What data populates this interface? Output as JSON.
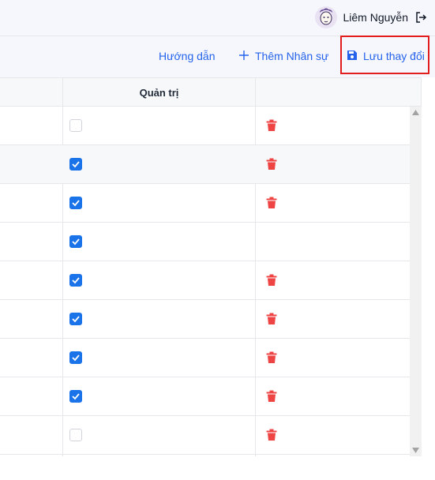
{
  "header": {
    "user_name": "Liêm Nguyễn",
    "avatar_icon": "avatar-face-icon",
    "logout_icon": "logout-icon"
  },
  "toolbar": {
    "guide_label": "Hướng dẫn",
    "add_label": "Thêm Nhân sự",
    "add_icon": "plus-icon",
    "save_label": "Lưu thay đổi",
    "save_icon": "floppy-disk-icon",
    "accent_color": "#2563eb",
    "highlight_color": "#e11d1d"
  },
  "table": {
    "columns": [
      "",
      "Quản trị",
      ""
    ],
    "rows": [
      {
        "admin": false,
        "deletable": true
      },
      {
        "admin": true,
        "deletable": true
      },
      {
        "admin": true,
        "deletable": true
      },
      {
        "admin": true,
        "deletable": false
      },
      {
        "admin": true,
        "deletable": true
      },
      {
        "admin": true,
        "deletable": true
      },
      {
        "admin": true,
        "deletable": true
      },
      {
        "admin": true,
        "deletable": true
      },
      {
        "admin": false,
        "deletable": true
      }
    ],
    "delete_icon": "trash-icon",
    "delete_color": "#ef4444",
    "checkbox_color": "#1a73e8"
  }
}
